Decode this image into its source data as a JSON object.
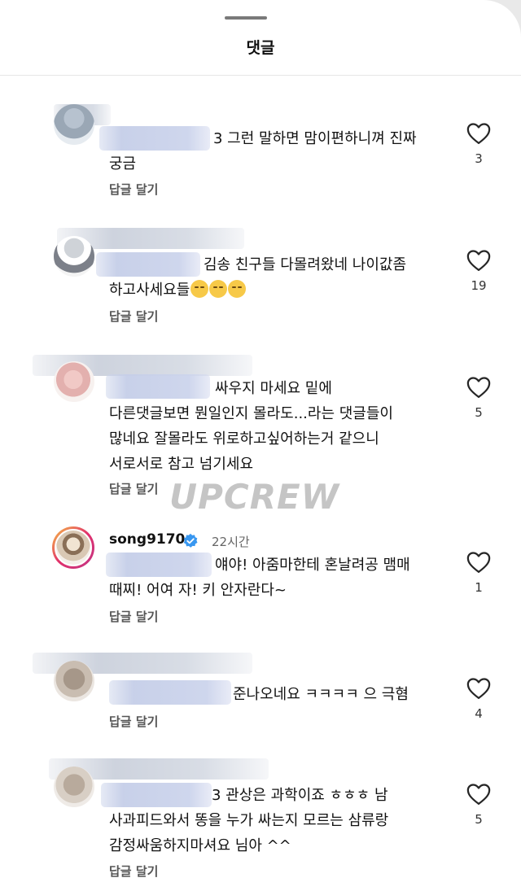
{
  "header": {
    "title": "댓글"
  },
  "reply_label": "답글 달기",
  "comments": [
    {
      "text": "3 그런 말하면 맘이편하니껴 진짜\n궁금",
      "likes": "3"
    },
    {
      "text": "김송 친구들 다몰려왔네 나이값좀\n하고사세요들",
      "likes": "19"
    },
    {
      "text": "싸우지 마세요 밑에\n다른댓글보면 뭔일인지 몰라도...라는 댓글들이\n많네요 잘몰라도 위로하고싶어하는거 같으니\n서로서로 참고 넘기세요",
      "likes": "5"
    },
    {
      "username": "song9170",
      "time": "22시간",
      "text": "얘야! 아줌마한테 혼날려공 맴매\n때찌! 어여 자! 키 안자란다~",
      "likes": "1"
    },
    {
      "text": "준나오네요 ㅋㅋㅋㅋ 으 극혐",
      "likes": "4"
    },
    {
      "text": "3 관상은 과학이죠 ㅎㅎㅎ 남\n사과피드와서 똥을 누가 싸는지 모르는 삼류랑\n감정싸움하지마셔요 님아 ^^",
      "likes": "5"
    }
  ],
  "watermark": "UPCREW",
  "colors": {
    "verified": "#3897f0",
    "like_outline": "#262626"
  }
}
